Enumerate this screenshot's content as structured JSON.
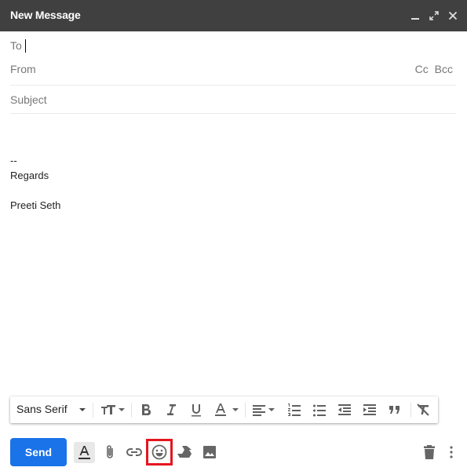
{
  "window": {
    "title": "New Message",
    "controls": [
      "minimize-icon",
      "fullscreen-icon",
      "close-icon"
    ]
  },
  "fields": {
    "to_label": "To",
    "to_value": "",
    "from_label": "From",
    "cc_label": "Cc",
    "bcc_label": "Bcc",
    "subject_placeholder": "Subject"
  },
  "body": {
    "lines": [
      "--",
      "Regards",
      "",
      "Preeti Seth"
    ]
  },
  "format_toolbar": {
    "font_family": "Sans Serif",
    "icons": [
      "text-size-icon",
      "bold-icon",
      "italic-icon",
      "underline-icon",
      "text-color-icon",
      "align-icon",
      "numbered-list-icon",
      "bulleted-list-icon",
      "indent-less-icon",
      "indent-more-icon",
      "quote-icon",
      "remove-formatting-icon"
    ]
  },
  "bottom_bar": {
    "send_label": "Send",
    "icons": [
      "formatting-options-icon",
      "attach-file-icon",
      "insert-link-icon",
      "insert-emoji-icon",
      "google-drive-icon",
      "insert-photo-icon",
      "discard-draft-icon",
      "more-options-icon"
    ],
    "highlighted": "insert-emoji-icon",
    "highlight_color": "#e5151f",
    "send_color": "#1a73e8"
  }
}
